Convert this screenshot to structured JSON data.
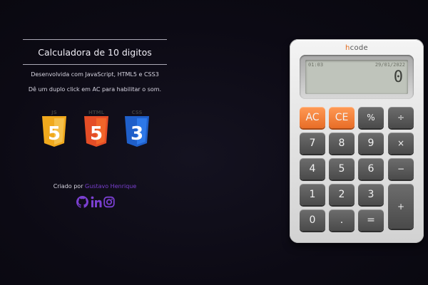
{
  "info": {
    "title": "Calculadora de 10 digitos",
    "description": "Desenvolvida com JavaScript, HTML5 e CSS3",
    "hint": "Dê um duplo click em AC para habilitar o som."
  },
  "tech_badges": [
    {
      "label": "JS",
      "number": "5",
      "color": "#f0a91d"
    },
    {
      "label": "HTML",
      "number": "5",
      "color": "#e44d26"
    },
    {
      "label": "CSS",
      "number": "3",
      "color": "#2965f1"
    }
  ],
  "credit": {
    "prefix": "Criado por",
    "author": "Gustavo Henrique",
    "author_color": "#7a3fd0"
  },
  "socials": [
    "github-icon",
    "linkedin-icon",
    "instagram-icon"
  ],
  "calculator": {
    "brand_h": "h",
    "brand_rest": "code",
    "lcd_time": "01:03",
    "lcd_date": "29/01/2022",
    "display_value": "0",
    "keys": [
      {
        "label": "AC",
        "style": "orange",
        "name": "ac-button"
      },
      {
        "label": "CE",
        "style": "orange",
        "name": "ce-button"
      },
      {
        "label": "%",
        "style": "op",
        "name": "percent-button"
      },
      {
        "label": "÷",
        "style": "op",
        "name": "divide-button"
      },
      {
        "label": "7",
        "name": "digit-7-button"
      },
      {
        "label": "8",
        "name": "digit-8-button"
      },
      {
        "label": "9",
        "name": "digit-9-button"
      },
      {
        "label": "×",
        "style": "op",
        "name": "multiply-button"
      },
      {
        "label": "4",
        "name": "digit-4-button"
      },
      {
        "label": "5",
        "name": "digit-5-button"
      },
      {
        "label": "6",
        "name": "digit-6-button"
      },
      {
        "label": "−",
        "style": "op",
        "name": "minus-button"
      },
      {
        "label": "1",
        "name": "digit-1-button"
      },
      {
        "label": "2",
        "name": "digit-2-button"
      },
      {
        "label": "3",
        "name": "digit-3-button"
      },
      {
        "label": "+",
        "style": "op",
        "name": "plus-button"
      },
      {
        "label": "0",
        "name": "digit-0-button"
      },
      {
        "label": ".",
        "name": "decimal-button"
      },
      {
        "label": "=",
        "name": "equals-button"
      }
    ]
  }
}
